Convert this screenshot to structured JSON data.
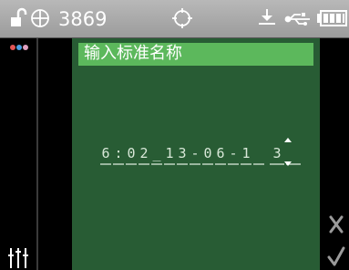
{
  "status_bar": {
    "device_id": "3869",
    "icons": [
      "lock-open-icon",
      "target-icon",
      "crosshair-icon",
      "download-icon",
      "usb-icon",
      "battery-icon"
    ]
  },
  "left_rail": {
    "icons": [
      "color-dots-icon",
      "sliders-icon"
    ],
    "dot_colors": [
      "#e05555",
      "#4a9ee0",
      "#e0a0c0"
    ]
  },
  "dialog": {
    "title": "输入标准名称",
    "field_chars": [
      "6",
      ":",
      "0",
      "2",
      "_",
      "1",
      "3",
      "-",
      "0",
      "6",
      "-",
      "1",
      "3"
    ],
    "cursor_index": 12
  },
  "right_rail": {
    "icons": [
      "cancel-icon",
      "confirm-icon"
    ]
  },
  "colors": {
    "panel": "#285c34",
    "title_bar": "#5cb85c",
    "status_bar": "#a8a8a8"
  }
}
